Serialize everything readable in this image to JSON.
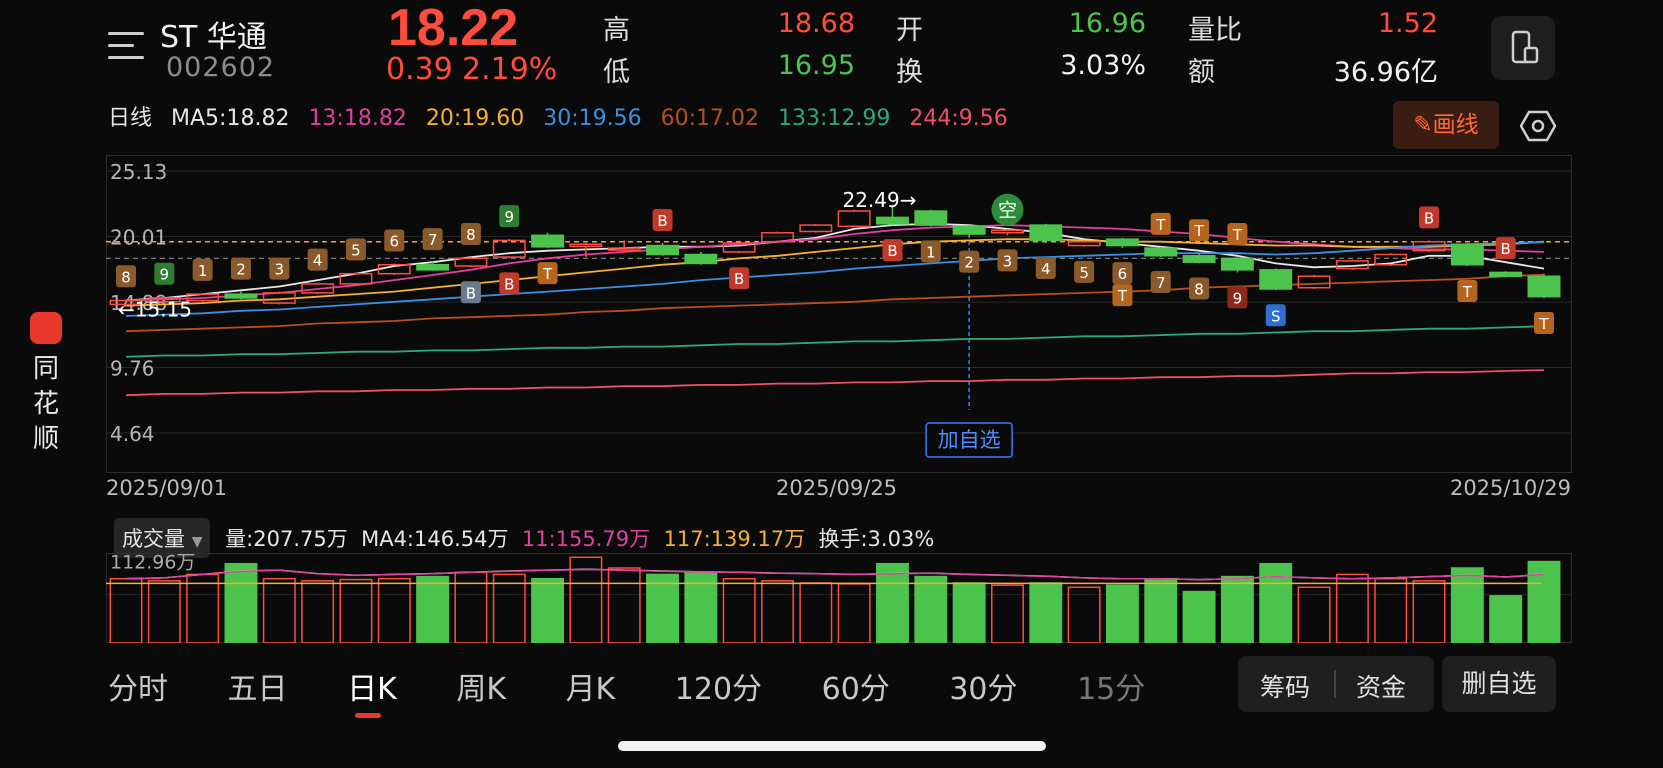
{
  "sidebar": {
    "app_name": "同花顺"
  },
  "header": {
    "name": "ST 华通",
    "code": "002602",
    "price": "18.22",
    "change": "0.39",
    "change_pct": "2.19%",
    "stats": {
      "high_label": "高",
      "high": "18.68",
      "low_label": "低",
      "low": "16.95",
      "open_label": "开",
      "open": "16.96",
      "turnover_label": "换",
      "turnover": "3.03%",
      "vol_ratio_label": "量比",
      "vol_ratio": "1.52",
      "amount_label": "额",
      "amount": "36.96亿"
    }
  },
  "ma_legend": {
    "period": "日线",
    "ma5": "MA5:18.82",
    "ma13": "13:18.82",
    "ma20": "20:19.60",
    "ma30": "30:19.56",
    "ma60": "60:17.02",
    "ma133": "133:12.99",
    "ma244": "244:9.56"
  },
  "toolbar": {
    "draw_label": "画线"
  },
  "chart_data": {
    "type": "candlestick",
    "y_ticks": [
      "25.13",
      "20.01",
      "14.88",
      "9.76",
      "4.64"
    ],
    "ylim": [
      4.64,
      25.13
    ],
    "x_labels": [
      "2025/09/01",
      "2025/09/25",
      "2025/10/29"
    ],
    "max_annotation": "22.49→",
    "min_annotation": "←15.15",
    "add_watch_label": "加自选",
    "short_marker": "空",
    "candles": [
      {
        "o": 14.7,
        "c": 15.0,
        "h": 15.1,
        "l": 14.6
      },
      {
        "o": 14.9,
        "c": 15.2,
        "h": 15.3,
        "l": 14.8
      },
      {
        "o": 15.0,
        "c": 15.5,
        "h": 15.6,
        "l": 14.9
      },
      {
        "o": 15.5,
        "c": 15.2,
        "h": 15.7,
        "l": 15.1
      },
      {
        "o": 14.8,
        "c": 15.6,
        "h": 15.7,
        "l": 14.7
      },
      {
        "o": 15.6,
        "c": 16.3,
        "h": 16.4,
        "l": 15.5
      },
      {
        "o": 16.3,
        "c": 17.1,
        "h": 17.2,
        "l": 16.2
      },
      {
        "o": 17.1,
        "c": 17.8,
        "h": 17.9,
        "l": 17.0
      },
      {
        "o": 17.8,
        "c": 17.4,
        "h": 18.0,
        "l": 17.3
      },
      {
        "o": 17.7,
        "c": 18.3,
        "h": 18.4,
        "l": 17.6
      },
      {
        "o": 18.4,
        "c": 19.7,
        "h": 19.8,
        "l": 18.3
      },
      {
        "o": 20.1,
        "c": 19.2,
        "h": 20.3,
        "l": 19.1
      },
      {
        "o": 19.3,
        "c": 19.4,
        "h": 19.5,
        "l": 18.4
      },
      {
        "o": 19.0,
        "c": 19.1,
        "h": 19.7,
        "l": 18.8
      },
      {
        "o": 19.3,
        "c": 18.6,
        "h": 19.5,
        "l": 18.5
      },
      {
        "o": 18.6,
        "c": 17.9,
        "h": 18.8,
        "l": 17.8
      },
      {
        "o": 18.8,
        "c": 19.5,
        "h": 19.6,
        "l": 18.7
      },
      {
        "o": 19.6,
        "c": 20.3,
        "h": 20.4,
        "l": 19.5
      },
      {
        "o": 20.4,
        "c": 20.9,
        "h": 21.0,
        "l": 20.3
      },
      {
        "o": 20.8,
        "c": 22.0,
        "h": 22.1,
        "l": 20.7
      },
      {
        "o": 21.5,
        "c": 21.0,
        "h": 22.49,
        "l": 20.9
      },
      {
        "o": 22.0,
        "c": 20.9,
        "h": 22.1,
        "l": 20.8
      },
      {
        "o": 20.8,
        "c": 20.2,
        "h": 20.9,
        "l": 20.0
      },
      {
        "o": 20.3,
        "c": 20.5,
        "h": 20.6,
        "l": 20.1
      },
      {
        "o": 20.9,
        "c": 19.7,
        "h": 21.0,
        "l": 19.5
      },
      {
        "o": 19.3,
        "c": 19.6,
        "h": 19.7,
        "l": 19.2
      },
      {
        "o": 19.8,
        "c": 19.3,
        "h": 19.9,
        "l": 19.1
      },
      {
        "o": 19.1,
        "c": 18.5,
        "h": 19.2,
        "l": 18.4
      },
      {
        "o": 18.5,
        "c": 18.0,
        "h": 18.7,
        "l": 17.9
      },
      {
        "o": 18.3,
        "c": 17.4,
        "h": 18.4,
        "l": 17.2
      },
      {
        "o": 17.4,
        "c": 15.9,
        "h": 17.5,
        "l": 15.8
      },
      {
        "o": 16.0,
        "c": 16.9,
        "h": 17.0,
        "l": 15.9
      },
      {
        "o": 17.5,
        "c": 18.1,
        "h": 18.2,
        "l": 17.4
      },
      {
        "o": 17.8,
        "c": 18.6,
        "h": 18.7,
        "l": 17.7
      },
      {
        "o": 18.9,
        "c": 19.6,
        "h": 19.7,
        "l": 18.8
      },
      {
        "o": 19.4,
        "c": 17.8,
        "h": 19.5,
        "l": 17.7
      },
      {
        "o": 17.2,
        "c": 16.9,
        "h": 17.3,
        "l": 16.8
      },
      {
        "o": 16.9,
        "c": 15.3,
        "h": 17.1,
        "l": 15.2
      }
    ],
    "lines": {
      "ma5": [
        15.0,
        15.2,
        15.5,
        15.8,
        16.1,
        16.6,
        17.1,
        17.7,
        18.0,
        18.4,
        18.7,
        18.9,
        19.0,
        19.1,
        19.2,
        19.2,
        19.3,
        19.6,
        19.9,
        20.6,
        20.9,
        21.0,
        20.9,
        20.6,
        20.3,
        19.8,
        19.5,
        19.2,
        18.9,
        18.5,
        17.9,
        17.6,
        17.7,
        17.9,
        18.5,
        18.5,
        18.0,
        17.5
      ],
      "ma13": [
        15.0,
        15.1,
        15.2,
        15.4,
        15.6,
        15.9,
        16.2,
        16.6,
        17.0,
        17.4,
        17.9,
        18.3,
        18.6,
        18.8,
        19.0,
        19.2,
        19.4,
        19.6,
        19.8,
        20.2,
        20.5,
        20.7,
        20.8,
        20.9,
        20.8,
        20.7,
        20.6,
        20.4,
        20.2,
        19.9,
        19.6,
        19.4,
        19.2,
        19.1,
        19.0,
        19.0,
        18.9,
        18.8
      ],
      "ma20": [
        14.6,
        14.7,
        14.8,
        15.0,
        15.1,
        15.3,
        15.5,
        15.7,
        16.0,
        16.3,
        16.6,
        16.9,
        17.2,
        17.5,
        17.8,
        18.0,
        18.3,
        18.5,
        18.8,
        19.1,
        19.4,
        19.6,
        19.7,
        19.8,
        19.8,
        19.7,
        19.6,
        19.6,
        19.5,
        19.4,
        19.3,
        19.3,
        19.2,
        19.2,
        19.2,
        19.3,
        19.4,
        19.6
      ],
      "ma30": [
        13.8,
        13.9,
        14.0,
        14.2,
        14.3,
        14.5,
        14.7,
        14.9,
        15.1,
        15.3,
        15.5,
        15.7,
        15.9,
        16.1,
        16.3,
        16.6,
        16.8,
        17.0,
        17.2,
        17.5,
        17.7,
        17.9,
        18.1,
        18.3,
        18.4,
        18.5,
        18.6,
        18.7,
        18.7,
        18.7,
        18.6,
        18.7,
        18.9,
        19.1,
        19.3,
        19.4,
        19.5,
        19.56
      ],
      "ma60": [
        12.6,
        12.7,
        12.8,
        12.9,
        13.0,
        13.2,
        13.3,
        13.4,
        13.6,
        13.7,
        13.8,
        13.9,
        14.1,
        14.2,
        14.4,
        14.5,
        14.6,
        14.7,
        14.8,
        14.9,
        15.1,
        15.2,
        15.3,
        15.4,
        15.5,
        15.6,
        15.7,
        15.8,
        16.0,
        16.1,
        16.2,
        16.3,
        16.4,
        16.5,
        16.6,
        16.7,
        16.9,
        17.02
      ],
      "ma133": [
        10.6,
        10.7,
        10.7,
        10.8,
        10.8,
        10.9,
        11.0,
        11.0,
        11.1,
        11.1,
        11.2,
        11.3,
        11.3,
        11.4,
        11.4,
        11.5,
        11.6,
        11.6,
        11.7,
        11.8,
        11.8,
        11.9,
        12.0,
        12.0,
        12.1,
        12.2,
        12.2,
        12.3,
        12.4,
        12.4,
        12.5,
        12.6,
        12.6,
        12.7,
        12.8,
        12.8,
        12.9,
        12.99
      ],
      "ma244": [
        7.6,
        7.7,
        7.7,
        7.8,
        7.8,
        7.9,
        7.9,
        8.0,
        8.0,
        8.1,
        8.1,
        8.2,
        8.2,
        8.3,
        8.3,
        8.4,
        8.4,
        8.5,
        8.5,
        8.6,
        8.6,
        8.7,
        8.7,
        8.8,
        8.8,
        8.9,
        8.9,
        9.0,
        9.0,
        9.1,
        9.1,
        9.2,
        9.3,
        9.3,
        9.4,
        9.4,
        9.5,
        9.56
      ]
    },
    "markers": [
      {
        "i": 0,
        "t": "8",
        "pos": "above",
        "c": "#8a5a2b"
      },
      {
        "i": 1,
        "t": "9",
        "pos": "above",
        "c": "#2e7d32"
      },
      {
        "i": 2,
        "t": "1",
        "pos": "above",
        "c": "#8a5a2b"
      },
      {
        "i": 3,
        "t": "2",
        "pos": "above",
        "c": "#8a5a2b"
      },
      {
        "i": 4,
        "t": "3",
        "pos": "above",
        "c": "#8a5a2b"
      },
      {
        "i": 5,
        "t": "4",
        "pos": "above",
        "c": "#8a5a2b"
      },
      {
        "i": 6,
        "t": "5",
        "pos": "above",
        "c": "#8a5a2b"
      },
      {
        "i": 7,
        "t": "6",
        "pos": "above",
        "c": "#8a5a2b"
      },
      {
        "i": 8,
        "t": "7",
        "pos": "above",
        "c": "#8a5a2b"
      },
      {
        "i": 9,
        "t": "8",
        "pos": "above",
        "c": "#8a5a2b"
      },
      {
        "i": 10,
        "t": "9",
        "pos": "above",
        "c": "#2e7d32"
      },
      {
        "i": 9,
        "t": "B",
        "pos": "below",
        "c": "#6b7b8c"
      },
      {
        "i": 10,
        "t": "B",
        "pos": "below",
        "c": "#c0392b"
      },
      {
        "i": 11,
        "t": "T",
        "pos": "below",
        "c": "#b5651d"
      },
      {
        "i": 14,
        "t": "B",
        "pos": "above",
        "c": "#c0392b"
      },
      {
        "i": 16,
        "t": "B",
        "pos": "below",
        "c": "#c0392b"
      },
      {
        "i": 20,
        "t": "B",
        "pos": "below",
        "c": "#c0392b"
      },
      {
        "i": 21,
        "t": "1",
        "pos": "below",
        "c": "#8a5a2b"
      },
      {
        "i": 22,
        "t": "2",
        "pos": "below",
        "c": "#8a5a2b"
      },
      {
        "i": 23,
        "t": "3",
        "pos": "below",
        "c": "#8a5a2b"
      },
      {
        "i": 24,
        "t": "4",
        "pos": "below",
        "c": "#8a5a2b"
      },
      {
        "i": 25,
        "t": "5",
        "pos": "below",
        "c": "#8a5a2b"
      },
      {
        "i": 26,
        "t": "6",
        "pos": "below",
        "c": "#8a5a2b"
      },
      {
        "i": 27,
        "t": "7",
        "pos": "below",
        "c": "#8a5a2b"
      },
      {
        "i": 28,
        "t": "8",
        "pos": "below",
        "c": "#8a5a2b"
      },
      {
        "i": 29,
        "t": "9",
        "pos": "below",
        "c": "#8b2a1a"
      },
      {
        "i": 27,
        "t": "T",
        "pos": "above",
        "c": "#b5651d"
      },
      {
        "i": 28,
        "t": "T",
        "pos": "above",
        "c": "#b5651d"
      },
      {
        "i": 29,
        "t": "T",
        "pos": "above",
        "c": "#b5651d"
      },
      {
        "i": 26,
        "t": "T",
        "pos": "below2",
        "c": "#b5651d"
      },
      {
        "i": 30,
        "t": "S",
        "pos": "below",
        "c": "#2f6fd1"
      },
      {
        "i": 34,
        "t": "B",
        "pos": "above",
        "c": "#c0392b"
      },
      {
        "i": 35,
        "t": "T",
        "pos": "below",
        "c": "#b5651d"
      },
      {
        "i": 36,
        "t": "B",
        "pos": "above",
        "c": "#c0392b"
      },
      {
        "i": 37,
        "t": "T",
        "pos": "below",
        "c": "#b5651d"
      }
    ],
    "volume": {
      "label": "成交量",
      "vol": "量:207.75万",
      "ma4": "MA4:146.54万",
      "ma11": "11:155.79万",
      "ma117": "117:139.17万",
      "turnover": "换手:3.03%",
      "ref_tick": "112.96万",
      "values": [
        150,
        145,
        160,
        185,
        150,
        145,
        148,
        150,
        155,
        165,
        160,
        150,
        200,
        175,
        160,
        165,
        150,
        145,
        140,
        138,
        185,
        155,
        140,
        135,
        140,
        130,
        135,
        150,
        120,
        155,
        185,
        130,
        160,
        150,
        145,
        175,
        110,
        190
      ],
      "ma_line": [
        150,
        152,
        160,
        168,
        170,
        162,
        158,
        160,
        162,
        165,
        168,
        170,
        172,
        170,
        168,
        166,
        165,
        163,
        162,
        160,
        162,
        163,
        160,
        158,
        156,
        152,
        150,
        150,
        148,
        150,
        155,
        152,
        150,
        152,
        155,
        158,
        154,
        160
      ]
    }
  },
  "tabs": [
    "分时",
    "五日",
    "日K",
    "周K",
    "月K",
    "120分",
    "60分",
    "30分",
    "15分"
  ],
  "active_tab": "日K",
  "bottom_tools": {
    "chips": "筹码",
    "funds": "资金",
    "remove_watch": "删自选"
  },
  "colors": {
    "up": "#ff4d3d",
    "down": "#4cc34c",
    "accent": "#e8372b"
  }
}
